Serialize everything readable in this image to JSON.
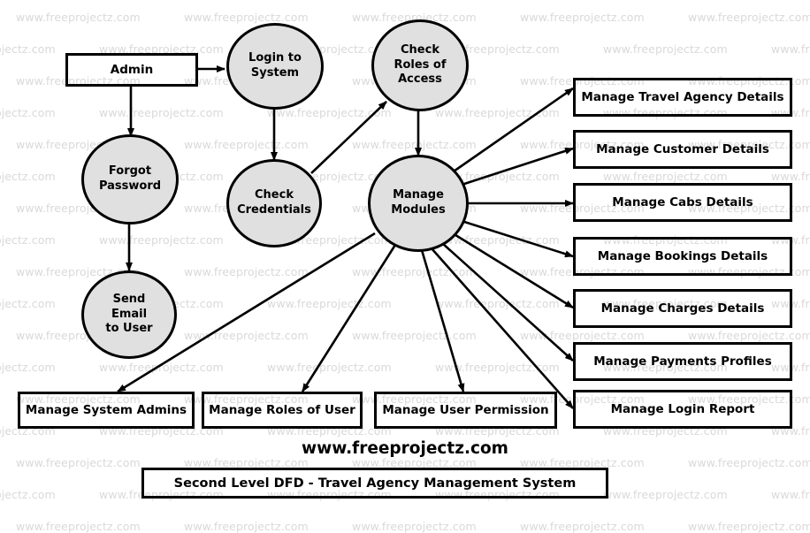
{
  "diagram": {
    "site_name": "www.freeprojectz.com",
    "caption": "Second Level DFD - Travel Agency Management System",
    "watermark_text": "www.freeprojectz.com",
    "colors": {
      "process_fill": "#e0e0e0",
      "stroke": "#000000",
      "watermark": "#d9d9d9",
      "background": "#ffffff"
    },
    "entities": {
      "admin": "Admin"
    },
    "processes": {
      "login_to_system": "Login to System",
      "check_roles_of_access": "Check Roles of Access",
      "forgot_password": "Forgot Password",
      "check_credentials": "Check Credentials",
      "send_email_to_user": "Send Email to User",
      "manage_modules": "Manage Modules"
    },
    "right_stores": [
      "Manage Travel Agency Details",
      "Manage Customer Details",
      "Manage Cabs Details",
      "Manage Bookings Details",
      "Manage Charges Details",
      "Manage Payments Profiles",
      "Manage Login Report"
    ],
    "bottom_stores": [
      "Manage System Admins",
      "Manage Roles of User",
      "Manage User Permission"
    ],
    "flows": [
      {
        "from": "Admin",
        "to": "Login to System"
      },
      {
        "from": "Admin",
        "to": "Forgot Password"
      },
      {
        "from": "Login to System",
        "to": "Check Credentials"
      },
      {
        "from": "Forgot Password",
        "to": "Send Email to User"
      },
      {
        "from": "Check Credentials",
        "to": "Check Roles of Access"
      },
      {
        "from": "Check Roles of Access",
        "to": "Manage Modules"
      },
      {
        "from": "Manage Modules",
        "to": "Manage Travel Agency Details"
      },
      {
        "from": "Manage Modules",
        "to": "Manage Customer Details"
      },
      {
        "from": "Manage Modules",
        "to": "Manage Cabs Details"
      },
      {
        "from": "Manage Modules",
        "to": "Manage Bookings Details"
      },
      {
        "from": "Manage Modules",
        "to": "Manage Charges Details"
      },
      {
        "from": "Manage Modules",
        "to": "Manage Payments Profiles"
      },
      {
        "from": "Manage Modules",
        "to": "Manage Login Report"
      },
      {
        "from": "Manage Modules",
        "to": "Manage System Admins"
      },
      {
        "from": "Manage Modules",
        "to": "Manage Roles of User"
      },
      {
        "from": "Manage Modules",
        "to": "Manage User Permission"
      }
    ]
  }
}
